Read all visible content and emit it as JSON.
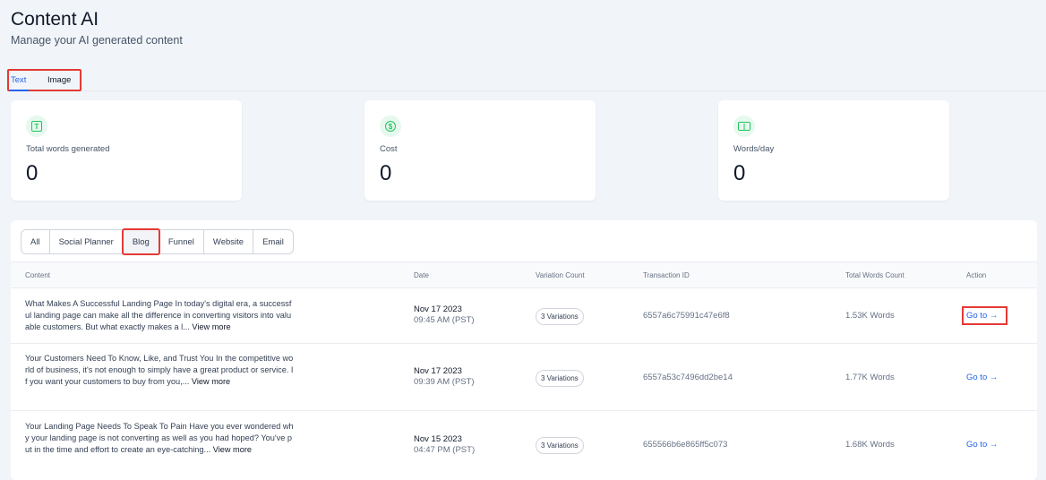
{
  "header": {
    "title": "Content AI",
    "subtitle": "Manage your AI generated content"
  },
  "tabs": [
    {
      "label": "Text",
      "active": true
    },
    {
      "label": "Image",
      "active": false
    }
  ],
  "stats": [
    {
      "icon": "text-icon",
      "label": "Total words generated",
      "value": "0"
    },
    {
      "icon": "dollar-icon",
      "label": "Cost",
      "value": "0"
    },
    {
      "icon": "words-per-day-icon",
      "label": "Words/day",
      "value": "0"
    }
  ],
  "filters": [
    "All",
    "Social Planner",
    "Blog",
    "Funnel",
    "Website",
    "Email"
  ],
  "active_filter": "Blog",
  "columns": [
    "Content",
    "Date",
    "Variation Count",
    "Transaction ID",
    "Total Words Count",
    "Action"
  ],
  "rows": [
    {
      "content": "What Makes A Successful Landing Page In today's digital era, a successful landing page can make all the difference in converting visitors into valuable customers. But what exactly makes a l...",
      "view_more": "View more",
      "date": "Nov 17 2023",
      "time": "09:45 AM (PST)",
      "variations": "3 Variations",
      "txid": "6557a6c75991c47e6f8",
      "words": "1.53K Words",
      "action": "Go to"
    },
    {
      "content": "Your Customers Need To Know, Like, and Trust You In the competitive world of business, it's not enough to simply have a great product or service. If you want your customers to buy from you,...",
      "view_more": "View more",
      "date": "Nov 17 2023",
      "time": "09:39 AM (PST)",
      "variations": "3 Variations",
      "txid": "6557a53c7496dd2be14",
      "words": "1.77K Words",
      "action": "Go to"
    },
    {
      "content": "Your Landing Page Needs To Speak To Pain Have you ever wondered why your landing page is not converting as well as you had hoped? You've put in the time and effort to create an eye-catching...",
      "view_more": "View more",
      "date": "Nov 15 2023",
      "time": "04:47 PM (PST)",
      "variations": "3 Variations",
      "txid": "655566b6e865ff5c073",
      "words": "1.68K Words",
      "action": "Go to"
    }
  ],
  "arrow": "→"
}
